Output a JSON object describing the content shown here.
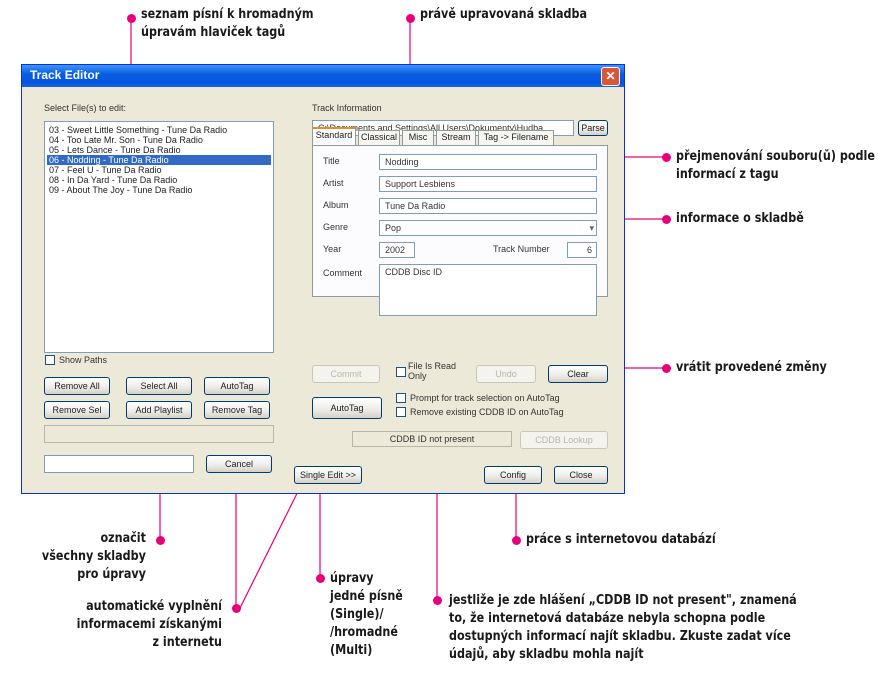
{
  "window": {
    "title": "Track Editor",
    "select_files_label": "Select File(s) to edit:",
    "tracks": [
      "03 - Sweet Little Something - Tune Da Radio",
      "04 - Too Late Mr. Son - Tune Da Radio",
      "05 - Lets Dance - Tune Da Radio",
      "06 - Nodding - Tune Da Radio",
      "07 - Feel U - Tune Da Radio",
      "08 - In Da Yard - Tune Da Radio",
      "09 - About The Joy - Tune Da Radio"
    ],
    "selected_track_index": 3,
    "show_paths_label": "Show Paths",
    "remove_all": "Remove All",
    "select_all": "Select All",
    "autotag_left": "AutoTag",
    "remove_sel": "Remove Sel",
    "add_playlist": "Add Playlist",
    "remove_tag": "Remove Tag",
    "cancel_left": "Cancel",
    "track_information_label": "Track Information",
    "path": "C:\\Documents and Settings\\All Users\\Dokumenty\\Hudba",
    "parse": "Parse",
    "tabs": [
      "Standard",
      "Classical",
      "Misc",
      "Stream",
      "Tag -> Filename"
    ],
    "fields": {
      "title_label": "Title",
      "title": "Nodding",
      "artist_label": "Artist",
      "artist": "Support Lesbiens",
      "album_label": "Album",
      "album": "Tune Da Radio",
      "genre_label": "Genre",
      "genre": "Pop",
      "year_label": "Year",
      "year": "2002",
      "track_number_label": "Track Number",
      "track_number": "6",
      "comment_label": "Comment",
      "comment": "CDDB Disc ID"
    },
    "commit": "Commit",
    "file_read_only": "File Is Read Only",
    "undo": "Undo",
    "clear": "Clear",
    "autotag_mid": "AutoTag",
    "prompt_check": "Prompt for track selection on AutoTag",
    "remove_cddb_check": "Remove existing CDDB ID on AutoTag",
    "cddb_status": "CDDB ID not present",
    "cddb_lookup": "CDDB Lookup",
    "single_edit": "Single Edit >>",
    "config": "Config",
    "close": "Close"
  },
  "annotations": {
    "song_list": [
      "seznam písní k hromadným",
      "úpravám hlaviček tagů"
    ],
    "current_track": [
      "právě upravovaná skladba"
    ],
    "rename": [
      "přejmenování souboru(ů) podle",
      "informací z tagu"
    ],
    "track_info": [
      "informace o skladbě"
    ],
    "revert": [
      "vrátit provedené změny"
    ],
    "select_all_note": [
      "označit",
      "všechny skladby",
      "pro úpravy"
    ],
    "autotag_note": [
      "automatické vyplnění",
      "informacemi získanými",
      "z internetu"
    ],
    "single_multi": [
      "úpravy",
      "jedné písně",
      "(Single)/",
      "/hromadné",
      "(Multi)"
    ],
    "internet_db": [
      "práce s internetovou databází"
    ],
    "cddb_note": [
      "jestliže je zde hlášení „CDDB ID not present\", znamená",
      "to, že internetová databáze nebyla schopna podle",
      "dostupných informací najít skladbu. Zkuste zadat více",
      "údajů, aby skladbu mohla najít"
    ]
  },
  "colors": {
    "annotation_dot": "#e8007a",
    "titlebar": "#0054e3",
    "selection": "#316ac5"
  }
}
